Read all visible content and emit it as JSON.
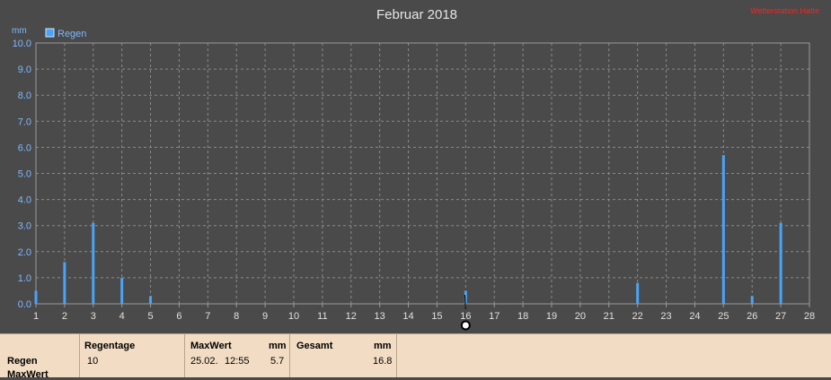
{
  "brand": "Wetterstation Hatte",
  "chart_data": {
    "type": "bar",
    "title": "Februar 2018",
    "unit": "mm",
    "legend": [
      {
        "name": "Regen",
        "color": "#4aa3f5"
      }
    ],
    "legend_position": "top-left",
    "grid": true,
    "ylim": [
      0,
      10
    ],
    "xlim": [
      1,
      28
    ],
    "y_ticks": [
      "0.0",
      "1.0",
      "2.0",
      "3.0",
      "4.0",
      "5.0",
      "6.0",
      "7.0",
      "8.0",
      "9.0",
      "10.0"
    ],
    "x_ticks": [
      "1",
      "2",
      "3",
      "4",
      "5",
      "6",
      "7",
      "8",
      "9",
      "10",
      "11",
      "12",
      "13",
      "14",
      "15",
      "16",
      "17",
      "18",
      "19",
      "20",
      "21",
      "22",
      "23",
      "24",
      "25",
      "26",
      "27",
      "28"
    ],
    "series": [
      {
        "name": "Regen",
        "color": "#4aa3f5",
        "x": [
          1,
          2,
          3,
          4,
          5,
          16,
          22,
          25,
          26,
          27
        ],
        "values": [
          0.5,
          1.6,
          3.1,
          1.0,
          0.3,
          0.5,
          0.8,
          5.7,
          0.3,
          3.1
        ]
      }
    ],
    "marker_x": 16
  },
  "summary": {
    "row_label_1": "Regen",
    "row_label_2": "MaxWert",
    "regentage_header": "Regentage",
    "regentage_value": "10",
    "maxwert_header": "MaxWert",
    "maxwert_unit": "mm",
    "maxwert_date": "25.02.",
    "maxwert_time": "12:55",
    "maxwert_value": "5.7",
    "gesamt_header": "Gesamt",
    "gesamt_unit": "mm",
    "gesamt_value": "16.8"
  }
}
